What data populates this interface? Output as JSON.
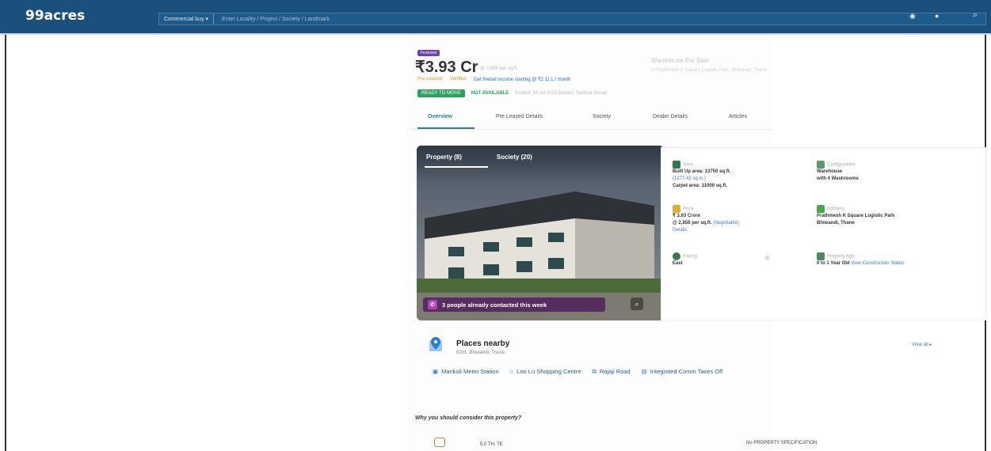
{
  "header": {
    "logo": "99acres",
    "filter_label": "Commercial buy ▾",
    "search_placeholder": "Enter Locality / Project / Society / Landmark",
    "icons": [
      "eye-icon",
      "user-icon",
      "search-icon"
    ]
  },
  "listing": {
    "badge": "Featured",
    "price": "₹3.93 Cr",
    "price_sub": "@ 2,856 per sq.ft.",
    "for_sale": "Warehouse For Sale",
    "for_sale_sub": "in Prathmesh K Square Logistic Park, Bhiwandi, Thane",
    "tag1": "Pre-Leased",
    "tag2": "Verified",
    "tag3": "Get Rental Income starting @ ₹2.11 L / month",
    "availability": "READY TO MOVE",
    "not_available": "NOT AVAILABLE",
    "note": "Posted: 30 Jul 2024 Builder: Sarthak Group"
  },
  "tabs": [
    "Overview",
    "Pre Leased Details",
    "Society",
    "Dealer Details",
    "Articles"
  ],
  "photo": {
    "tab1": "Property (8)",
    "tab2": "Society (20)",
    "contacted": "3 people already contacted this week"
  },
  "details": {
    "area_label": "Area",
    "area_value": "Built Up area: 13750 sq.ft.",
    "area_link": "(1277.42 sq.m.)",
    "carpet": "Carpet area: 11000 sq.ft.",
    "config_label": "Configuration",
    "config_value1": "Warehouse",
    "config_value2": "with 4 Washrooms",
    "price_label": "Price",
    "price_value": "₹ 3.93 Crore",
    "price_sub": "@ 2,856 per sq.ft.",
    "price_link": "(Negotiable)",
    "price_more": "Details",
    "address_label": "Address",
    "address_value1": "Prathmesh K Square Logistic Park",
    "address_value2": "Bhiwandi, Thane",
    "facing_label": "Facing",
    "facing_value": "East",
    "age_label": "Property Age",
    "age_value": "0 to 1 Year Old",
    "age_link": "View Construction Status"
  },
  "places": {
    "title": "Places nearby",
    "subtitle": "6201, Bhiwandi, Thane",
    "view_all": "View all ▸",
    "items": [
      "Mankoli Metro Station",
      "Loo Lu Shopping Centre",
      "Rajaji Road",
      "Integrated Comm Taxes Off"
    ]
  },
  "why": "Why you should consider this property?",
  "bottom": {
    "a": "5.0 TH. TE",
    "b": "No PROPERTY SPECIFICATION"
  }
}
